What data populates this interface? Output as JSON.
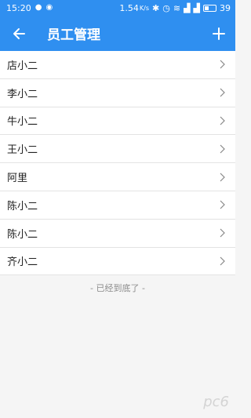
{
  "status_bar": {
    "time": "15:20",
    "speed": "1.54",
    "speed_unit": "K/s",
    "battery": "39"
  },
  "app_bar": {
    "title": "员工管理"
  },
  "employees": [
    {
      "name": "店小二"
    },
    {
      "name": "李小二"
    },
    {
      "name": "牛小二"
    },
    {
      "name": "王小二"
    },
    {
      "name": "阿里"
    },
    {
      "name": "陈小二"
    },
    {
      "name": "陈小二"
    },
    {
      "name": "齐小二"
    }
  ],
  "footer": {
    "end_text": "- 已经到底了 -"
  },
  "watermark": "pc6",
  "colors": {
    "primary": "#2f8ff0",
    "background": "#f5f5f5"
  }
}
